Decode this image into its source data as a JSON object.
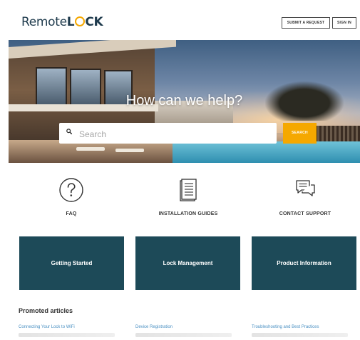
{
  "header": {
    "logo": {
      "part1": "Remote",
      "part2_l": "L",
      "part2_rest": "CK"
    },
    "submit_request": "SUBMIT A REQUEST",
    "sign_in": "SIGN IN"
  },
  "hero": {
    "title": "How can we help?",
    "search": {
      "placeholder": "Search",
      "button": "SEARCH"
    }
  },
  "categories": [
    {
      "label": "FAQ",
      "icon": "question-circle-icon"
    },
    {
      "label": "INSTALLATION GUIDES",
      "icon": "document-icon"
    },
    {
      "label": "CONTACT SUPPORT",
      "icon": "chat-bubbles-icon"
    }
  ],
  "tiles": [
    {
      "label": "Getting Started"
    },
    {
      "label": "Lock Management"
    },
    {
      "label": "Product Information"
    }
  ],
  "promoted": {
    "title": "Promoted articles",
    "articles": [
      {
        "title": "Connecting Your Lock to WiFi"
      },
      {
        "title": "Device Registration"
      },
      {
        "title": "Troubleshooting and Best Practices"
      }
    ]
  },
  "colors": {
    "brand_dark": "#1d4a58",
    "accent": "#f5a800",
    "link": "#4a90c2"
  }
}
